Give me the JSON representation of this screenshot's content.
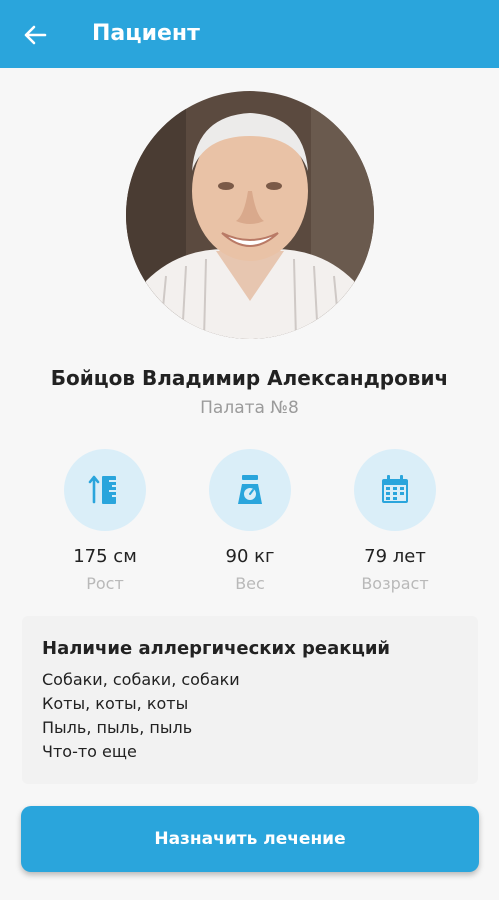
{
  "appbar": {
    "title": "Пациент",
    "back_icon": "arrow-left-icon",
    "color": "#2aa5dc"
  },
  "patient": {
    "name": "Бойцов Владимир Александрович",
    "room": "Палата №8"
  },
  "stats": [
    {
      "icon": "ruler-icon",
      "value": "175 см",
      "label": "Рост"
    },
    {
      "icon": "scale-icon",
      "value": "90 кг",
      "label": "Вес"
    },
    {
      "icon": "calendar-icon",
      "value": "79 лет",
      "label": "Возраст"
    }
  ],
  "allergies": {
    "title": "Наличие аллергических реакций",
    "items": [
      "Собаки, собаки, собаки",
      "Коты, коты, коты",
      "Пыль, пыль, пыль",
      "Что-то еще"
    ]
  },
  "action_button": {
    "label": "Назначить лечение"
  }
}
